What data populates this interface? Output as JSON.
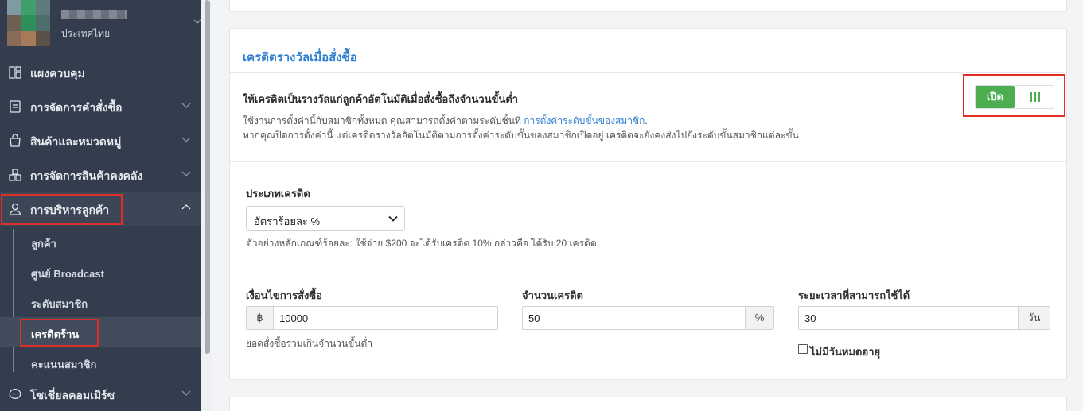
{
  "sidebar": {
    "store": {
      "country": "ประเทศไทย"
    },
    "menu": [
      {
        "key": "dashboard",
        "label": "แผงควบคุม"
      },
      {
        "key": "orders",
        "label": "การจัดการคำสั่งซื้อ"
      },
      {
        "key": "products",
        "label": "สินค้าและหมวดหมู่"
      },
      {
        "key": "inventory",
        "label": "การจัดการสินค้าคงคลัง"
      },
      {
        "key": "customers",
        "label": "การบริหารลูกค้า"
      },
      {
        "key": "social",
        "label": "โซเชี่ยลคอมเมิร์ซ"
      }
    ],
    "submenu": [
      {
        "label": "ลูกค้า"
      },
      {
        "label": "ศูนย์ Broadcast"
      },
      {
        "label": "ระดับสมาชิก"
      },
      {
        "label": "เครดิตร้าน"
      },
      {
        "label": "คะแนนสมาชิก"
      }
    ]
  },
  "card": {
    "title": "เครดิตรางวัลเมื่อสั่งซื้อ",
    "auto": {
      "title": "ให้เครดิตเป็นรางวัลแก่ลูกค้าอัตโนมัติเมื่อสั่งซื้อถึงจำนวนขั้นต่ำ",
      "desc1_prefix": "ใช้งานการตั้งค่านี้กับสมาชิกทั้งหมด คุณสามารถตั้งค่าตามระดับชั้นที่ ",
      "desc1_link": "การตั้งค่าระดับขั้นของสมาชิก",
      "desc1_suffix": ".",
      "desc2": "หากคุณปิดการตั้งค่านี้ แต่เครดิตรางวัลอัตโนมัติตามการตั้งค่าระดับขั้นของสมาชิกเปิดอยู่ เครดิตจะยังคงส่งไปยังระดับขั้นสมาชิกแต่ละขั้น",
      "toggle_on_label": "เปิด"
    },
    "credit_type": {
      "label": "ประเภทเครดิต",
      "selected": "อัตราร้อยละ %",
      "hint": "ตัวอย่างหลักเกณฑ์ร้อยละ: ใช้จ่าย $200 จะได้รับเครดิต 10% กล่าวคือ ได้รับ 20 เครดิต"
    },
    "order_condition": {
      "label": "เงื่อนไขการสั่งซื้อ",
      "prefix": "฿",
      "value": "10000",
      "hint": "ยอดสั่งซื้อรวมเกินจำนวนขั้นต่ำ"
    },
    "credit_amount": {
      "label": "จำนวนเครดิต",
      "value": "50",
      "suffix": "%"
    },
    "validity": {
      "label": "ระยะเวลาที่สามารถใช้ได้",
      "value": "30",
      "suffix": "วัน",
      "no_expiry_label": "ไม่มีวันหมดอายุ"
    }
  },
  "colors": {
    "accent": "#2f7fd0",
    "toggle_on": "#4cae4f",
    "highlight": "#e02d25",
    "sidebar_bg": "#333d4e"
  }
}
